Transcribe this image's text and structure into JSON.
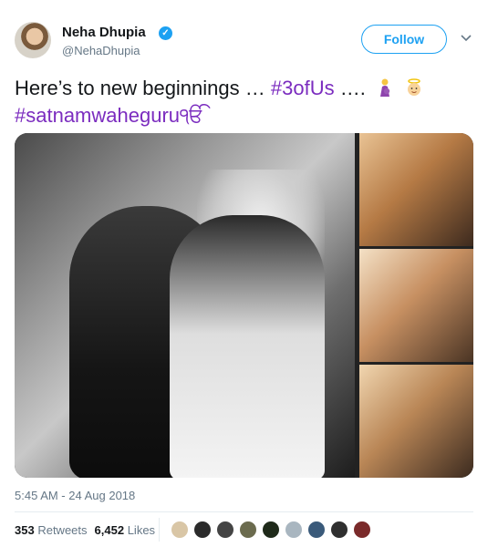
{
  "header": {
    "name": "Neha Dhupia",
    "handle": "@NehaDhupia",
    "follow_label": "Follow",
    "verified_icon": "verified-badge-icon"
  },
  "tweet": {
    "text_plain": "Here’s to new beginnings … ",
    "hashtag1": "#3ofUs",
    "ellipsis": " …. ",
    "hashtag2": "#satnamwaheguruੴ",
    "emojis": [
      "woman-pregnant-emoji",
      "angel-baby-emoji"
    ]
  },
  "media": {
    "photos": [
      "main-photo",
      "side-photo-1",
      "side-photo-2",
      "side-photo-3"
    ]
  },
  "meta": {
    "timestamp": "5:45 AM - 24 Aug 2018",
    "retweets_count": "353",
    "retweets_label": "Retweets",
    "likes_count": "6,452",
    "likes_label": "Likes"
  },
  "colors": {
    "accent": "#1da1f2",
    "hashtag": "#7b2cbf",
    "muted": "#657786"
  },
  "likers": [
    {
      "name": "liker-avatar-1",
      "color": "#d9c6a6"
    },
    {
      "name": "liker-avatar-2",
      "color": "#2b2b2b"
    },
    {
      "name": "liker-avatar-3",
      "color": "#444444"
    },
    {
      "name": "liker-avatar-4",
      "color": "#6b6b4e"
    },
    {
      "name": "liker-avatar-5",
      "color": "#1f2a1a"
    },
    {
      "name": "liker-avatar-6",
      "color": "#a9b6c0"
    },
    {
      "name": "liker-avatar-7",
      "color": "#3a5a7a"
    },
    {
      "name": "liker-avatar-8",
      "color": "#2f2f2f"
    },
    {
      "name": "liker-avatar-9",
      "color": "#7a2a2a"
    }
  ]
}
